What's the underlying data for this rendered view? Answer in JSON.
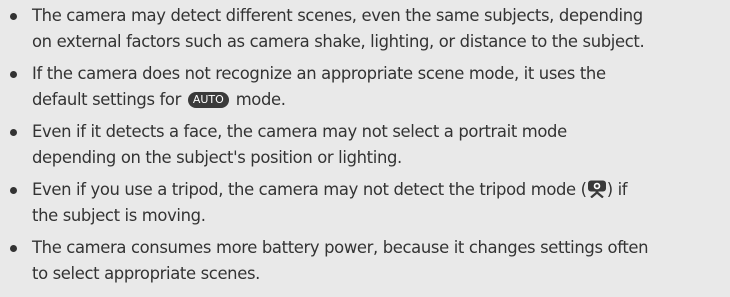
{
  "notes": {
    "item1_text": "The camera may detect different scenes, even the same subjects, depending on external factors such as camera shake, lighting, or distance to the subject.",
    "item2_before": "If the camera does not recognize an appropriate scene mode, it uses the default settings for ",
    "item2_badge": "AUTO",
    "item2_after": " mode.",
    "item3_text": "Even if it detects a face, the camera may not select a portrait mode depending on the subject's position or lighting.",
    "item4_before": "Even if you use a tripod, the camera may not detect the tripod mode (",
    "item4_after": ") if the subject is moving.",
    "item5_text": "The camera consumes more battery power, because it changes settings often to select appropriate scenes."
  },
  "icons": {
    "bullet": "bullet-dot",
    "tripod": "tripod-mode-icon"
  },
  "colors": {
    "background": "#e9e9e9",
    "text": "#333333",
    "badge_background": "#3a3a3a",
    "badge_text": "#ffffff"
  }
}
